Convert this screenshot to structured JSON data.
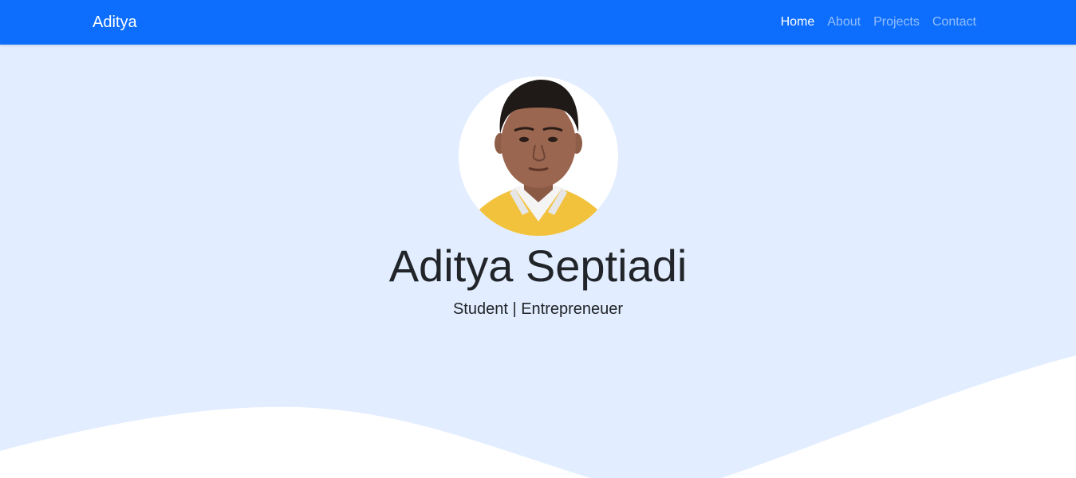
{
  "navbar": {
    "brand": "Aditya",
    "links": [
      {
        "label": "Home",
        "active": true
      },
      {
        "label": "About",
        "active": false
      },
      {
        "label": "Projects",
        "active": false
      },
      {
        "label": "Contact",
        "active": false
      }
    ]
  },
  "hero": {
    "name": "Aditya Septiadi",
    "subtitle": "Student | Entrepreneuer",
    "avatar": "profile-photo"
  },
  "colors": {
    "navbar": "#0d6efd",
    "hero_bg": "#e2edff",
    "wave": "#ffffff",
    "text": "#212529"
  }
}
